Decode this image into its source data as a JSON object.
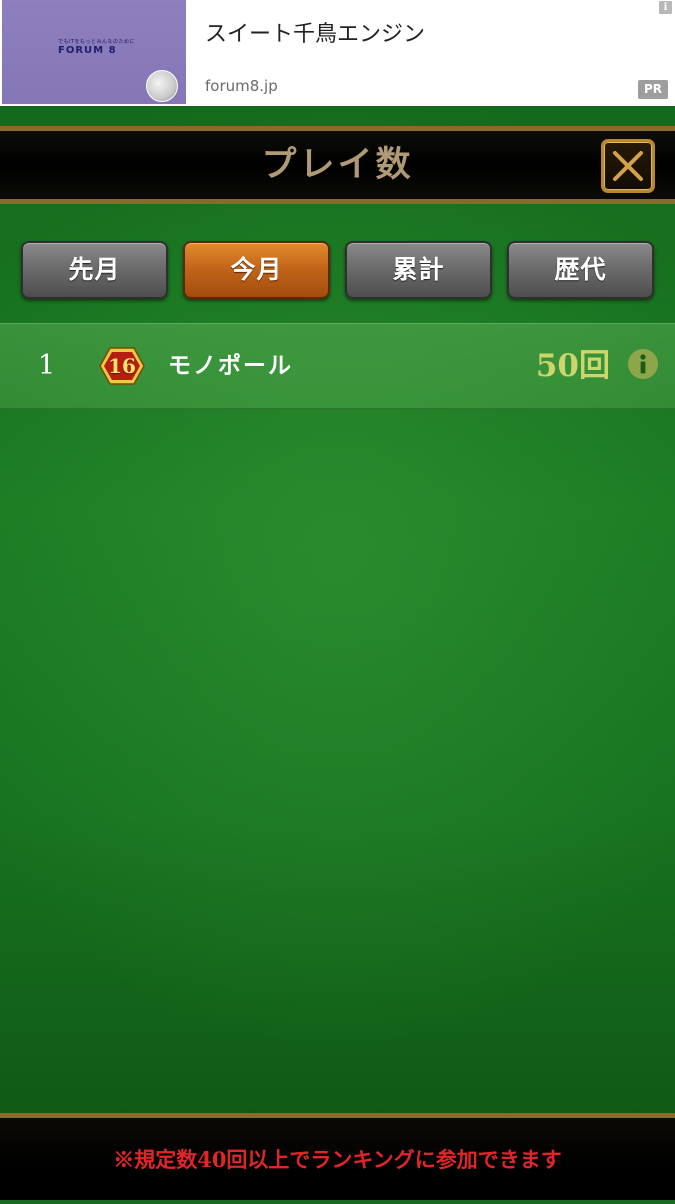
{
  "ad": {
    "tagline": "でもITをもっとみんなのために",
    "logo": "FORUM 8",
    "title": "スイート千鳥エンジン",
    "domain": "forum8.jp",
    "badge": "PR",
    "info_symbol": "i"
  },
  "header": {
    "title": "プレイ数",
    "close_icon": "close-x-icon"
  },
  "tabs": [
    {
      "label": "先月",
      "active": false
    },
    {
      "label": "今月",
      "active": true
    },
    {
      "label": "累計",
      "active": false
    },
    {
      "label": "歴代",
      "active": false
    }
  ],
  "ranking": [
    {
      "rank": "1",
      "level": "16",
      "name": "モノポール",
      "count": "50回",
      "icon": "info-icon"
    }
  ],
  "footer": {
    "note": "※規定数40回以上でランキングに参加できます"
  },
  "colors": {
    "felt": "#1a7a22",
    "gold_border": "#b8872e",
    "active_tab": "#c4661a",
    "inactive_tab": "#6c6c6c",
    "count_text": "#cdd66a",
    "footer_text": "#e1262a",
    "title_text": "#b09a76"
  }
}
